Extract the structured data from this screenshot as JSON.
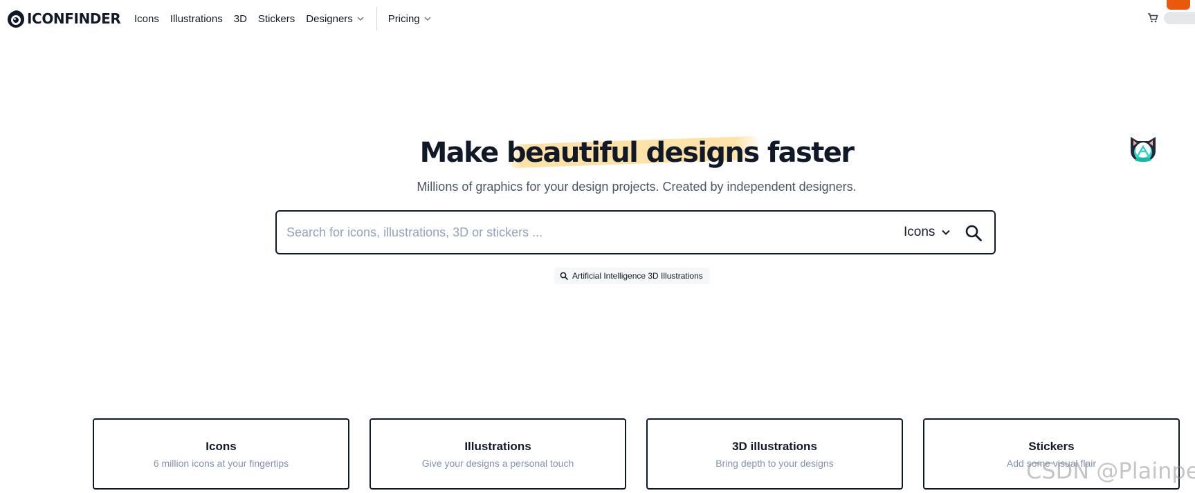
{
  "header": {
    "logo_text": "ICONFINDER",
    "nav": [
      {
        "label": "Icons"
      },
      {
        "label": "Illustrations"
      },
      {
        "label": "3D"
      },
      {
        "label": "Stickers"
      },
      {
        "label": "Designers"
      },
      {
        "label": "Pricing"
      }
    ]
  },
  "hero": {
    "title_before": "Make ",
    "title_highlight": "beautiful designs",
    "title_after": " faster",
    "subtitle": "Millions of graphics for your design projects. Created by independent designers.",
    "highlight_color": "#fde2a7"
  },
  "search": {
    "placeholder": "Search for icons, illustrations, 3D or stickers ...",
    "value": "",
    "type_selected": "Icons"
  },
  "suggestion": {
    "label": "Artificial Intelligence 3D Illustrations"
  },
  "categories": [
    {
      "title": "Icons",
      "description": "6 million icons at your fingertips"
    },
    {
      "title": "Illustrations",
      "description": "Give your designs a personal touch"
    },
    {
      "title": "3D illustrations",
      "description": "Bring depth to your designs"
    },
    {
      "title": "Stickers",
      "description": "Add some visual flair"
    }
  ],
  "watermark": "CSDN @Plainper",
  "icons": {
    "logo": "eye-logo-icon",
    "chevron": "chevron-down-icon",
    "cart": "cart-icon",
    "search": "search-icon",
    "mascot": "cat-mascot-icon"
  },
  "colors": {
    "text": "#111827",
    "muted": "#8193ab",
    "placeholder": "#94a3b8",
    "accent_orange": "#ea580c",
    "mascot_teal": "#2dd4bf"
  }
}
